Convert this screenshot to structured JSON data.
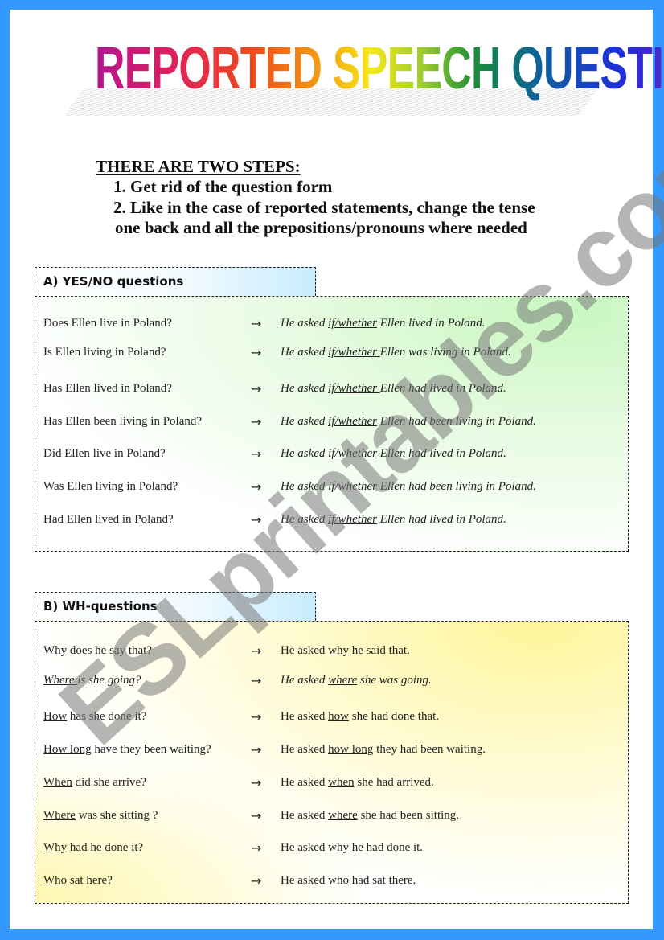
{
  "title": "REPORTED SPEECH QUESTIONS",
  "intro": {
    "heading": "THERE ARE TWO STEPS:",
    "steps": [
      "1.  Get rid of the question form",
      "2.  Like in the case of reported statements, change the tense",
      "one back and all the prepositions/pronouns where needed"
    ]
  },
  "arrow_symbol": "→",
  "sections": [
    {
      "title": "A) YES/NO questions",
      "rows": [
        {
          "question": "Does Ellen live in Poland?",
          "answer_pre": "He asked ",
          "answer_key": "if/whether",
          "answer_post": " Ellen lived in Poland."
        },
        {
          "question": "Is Ellen living in Poland?",
          "answer_pre": "He asked ",
          "answer_key": "if/whether ",
          "answer_post": "Ellen was living in Poland."
        },
        {
          "question": "Has Ellen lived in Poland?",
          "answer_pre": "He asked ",
          "answer_key": "if/whether ",
          "answer_post": "Ellen had lived in Poland."
        },
        {
          "question": "Has Ellen been living in Poland?",
          "answer_pre": "He asked ",
          "answer_key": "if/whether",
          "answer_post": " Ellen had been living in Poland."
        },
        {
          "question": "Did Ellen live in Poland?",
          "answer_pre": "He asked ",
          "answer_key": "if/whether",
          "answer_post": " Ellen had lived in Poland."
        },
        {
          "question": "Was Ellen living in Poland?",
          "answer_pre": "He asked ",
          "answer_key": "if/whether",
          "answer_post": " Ellen  had been living in Poland."
        },
        {
          "question": "Had Ellen lived in Poland?",
          "answer_pre": "He asked ",
          "answer_key": "if/whether",
          "answer_post": " Ellen had lived in Poland."
        }
      ]
    },
    {
      "title": "B) WH-questions",
      "rows": [
        {
          "q_key": "Why",
          "q_rest": " does he say that?",
          "answer_pre": "He asked ",
          "answer_key": "why",
          "answer_post": " he said that."
        },
        {
          "q_key": "Where ",
          "q_rest": "is she going?",
          "answer_pre": "He asked ",
          "answer_key": "where",
          "answer_post": " she was going."
        },
        {
          "q_key": "How",
          "q_rest": " has she done it?",
          "answer_pre": "He asked ",
          "answer_key": "how",
          "answer_post": " she had done that."
        },
        {
          "q_key": "How long",
          "q_rest": " have they been waiting?",
          "answer_pre": "He asked ",
          "answer_key": "how long",
          "answer_post": " they had been waiting."
        },
        {
          "q_key": "When",
          "q_rest": " did she arrive?",
          "answer_pre": "He asked ",
          "answer_key": "when",
          "answer_post": " she had arrived."
        },
        {
          "q_key": "Where",
          "q_rest": " was she sitting ?",
          "answer_pre": "He asked ",
          "answer_key": "where",
          "answer_post": " she had been sitting."
        },
        {
          "q_key": "Why",
          "q_rest": " had he done it?",
          "answer_pre": "He asked ",
          "answer_key": "why",
          "answer_post": " he had done it."
        },
        {
          "q_key": "Who",
          "q_rest": " sat here?",
          "answer_pre": "He asked ",
          "answer_key": "who",
          "answer_post": " had sat there."
        }
      ]
    }
  ],
  "watermark": "ESLprintables.com",
  "colors": {
    "frame": "#3399ff",
    "section_a_tint": "#c8f7c0",
    "section_b_tint": "#fff59a",
    "tab_tint": "#c9ecff"
  }
}
